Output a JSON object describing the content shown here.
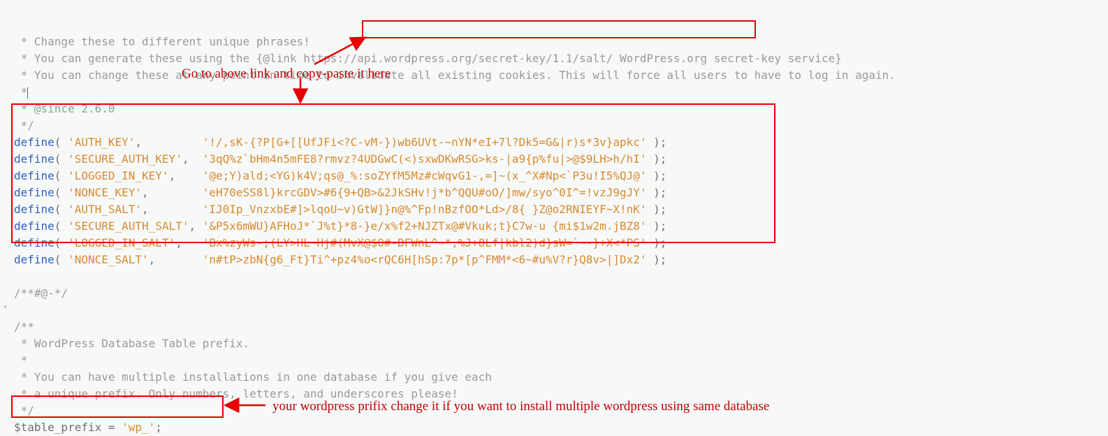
{
  "comments": {
    "line1": " * Change these to different unique phrases!",
    "line2a": " * You can generate these using the {@link ",
    "line2_link": "https://api.wordpress.org/secret-key/1.1/salt/",
    "line2b": " WordPress.org secret-key service}",
    "line3": " * You can change these at any point in time to invalidate all existing cookies. This will force all users to have to log in again.",
    "line4": " *",
    "line5": " * @since 2.6.0",
    "line6": " */",
    "sep": "/**#@-*/",
    "db1": "/**",
    "db2": " * WordPress Database Table prefix.",
    "db3": " *",
    "db4": " * You can have multiple installations in one database if you give each",
    "db5": " * a unique prefix. Only numbers, letters, and underscores please!",
    "db6": " */"
  },
  "defines": [
    {
      "key": "'AUTH_KEY'",
      "pad": "         ",
      "val": "'!/,sK-{?P[G+[[UfJFi<?C-vM-})wb6UVt-~nYN*eI+7l?Dk5=G&|r)s*3v}apkc'"
    },
    {
      "key": "'SECURE_AUTH_KEY'",
      "pad": "  ",
      "val": "'3qQ%z`bHm4n5mFE8?rmvz?4UDGwC(<)sxwDKwRSG>ks-|a9{p%fu|>@$9LH>h/hI'"
    },
    {
      "key": "'LOGGED_IN_KEY'",
      "pad": "    ",
      "val": "'@e;Y)ald;<YG)k4V;qs@_%:soZYfM5Mz#cWqvG1-,=]~(x_^X#Np<`P3u!I5%QJ@'"
    },
    {
      "key": "'NONCE_KEY'",
      "pad": "        ",
      "val": "'eH70eSS8l}krcGDV>#6{9+QB>&2JkSHv!j*b^QQU#oO/]mw/syo^0I^=!vzJ9gJY'"
    },
    {
      "key": "'AUTH_SALT'",
      "pad": "        ",
      "val": "'IJ0Ip_VnzxbE#]>lqoU~v)GtW]}n@%^Fp!nBzfOO*Ld>/8{ }Z@o2RNIEYF~X!nK'"
    },
    {
      "key": "'SECURE_AUTH_SALT'",
      "pad": " ",
      "val": "'&P5x6mWU}AFHoJ*`J%t}*8-}e/x%f2+NJZTx@#Vkuk;t}C7w-u {mi$1w2m.jBZ8'"
    },
    {
      "key": "'LOGGED_IN_SALT'",
      "pad": "   ",
      "val": "'Bx%zyWs-;(LY>HL~Hj#(MvX@$0#-DFWnL^~*,%J+8Lf|kbl2)d}sW=`~-}+X<*PS'"
    },
    {
      "key": "'NONCE_SALT'",
      "pad": "       ",
      "val": "'n#tP>zbN{g6_Ft}Ti^+pz4%o<rQC6H[hSp:7p*[p^FMM*<6~#u%V?r}Q8v>|]Dx2'"
    }
  ],
  "prefix": {
    "var": "$table_prefix",
    "eq": " = ",
    "val": "'wp_'",
    "semi": ";"
  },
  "annotations": {
    "top": "Go to above link and copy-paste it here",
    "bottom": "your wordpress prifix change it if you want to install multiple wordpress using same database"
  }
}
